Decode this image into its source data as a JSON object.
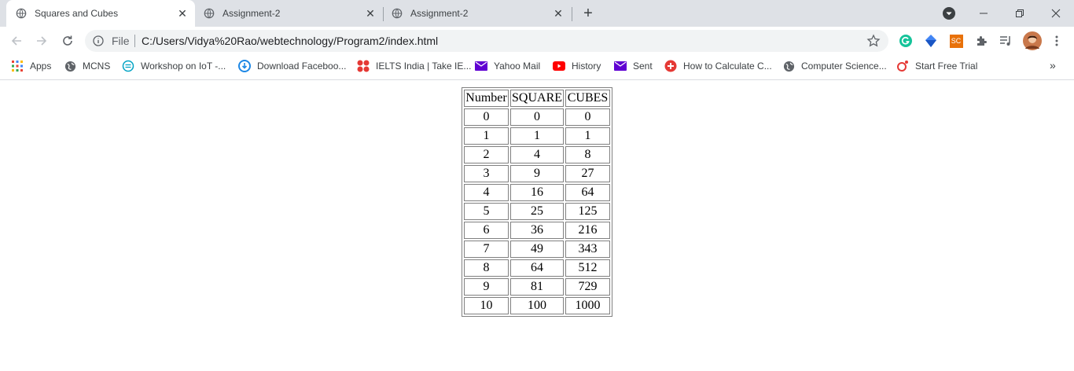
{
  "tabs": [
    {
      "title": "Squares and Cubes",
      "active": true
    },
    {
      "title": "Assignment-2",
      "active": false
    },
    {
      "title": "Assignment-2",
      "active": false
    }
  ],
  "address_bar": {
    "scheme_label": "File",
    "url": "C:/Users/Vidya%20Rao/webtechnology/Program2/index.html"
  },
  "extensions": [
    "grammarly-icon",
    "diamond-extension-icon",
    "sc-extension-icon",
    "puzzle-extensions-icon",
    "reading-list-icon",
    "avatar"
  ],
  "extension_sc_label": "SC",
  "bookmarks": [
    {
      "label": "Apps",
      "icon": "apps-grid-icon"
    },
    {
      "label": "MCNS",
      "icon": "globe-icon"
    },
    {
      "label": "Workshop on IoT -...",
      "icon": "iot-icon"
    },
    {
      "label": "Download Faceboo...",
      "icon": "download-icon"
    },
    {
      "label": "IELTS India | Take IE...",
      "icon": "ielts-icon"
    },
    {
      "label": "Yahoo Mail",
      "icon": "yahoo-mail-icon"
    },
    {
      "label": "History",
      "icon": "youtube-icon"
    },
    {
      "label": "Sent",
      "icon": "yahoo-mail-icon"
    },
    {
      "label": "How to Calculate C...",
      "icon": "plus-circle-icon"
    },
    {
      "label": "Computer Science...",
      "icon": "globe-icon"
    },
    {
      "label": "Start Free Trial",
      "icon": "trial-icon"
    }
  ],
  "table": {
    "headers": [
      "Number",
      "SQUARE",
      "CUBES"
    ],
    "rows": [
      [
        "0",
        "0",
        "0"
      ],
      [
        "1",
        "1",
        "1"
      ],
      [
        "2",
        "4",
        "8"
      ],
      [
        "3",
        "9",
        "27"
      ],
      [
        "4",
        "16",
        "64"
      ],
      [
        "5",
        "25",
        "125"
      ],
      [
        "6",
        "36",
        "216"
      ],
      [
        "7",
        "49",
        "343"
      ],
      [
        "8",
        "64",
        "512"
      ],
      [
        "9",
        "81",
        "729"
      ],
      [
        "10",
        "100",
        "1000"
      ]
    ]
  },
  "colors": {
    "tabstrip_bg": "#dee1e6",
    "omnibox_bg": "#f1f3f4",
    "grammarly": "#15c39a",
    "sc_orange": "#e8710a",
    "youtube_red": "#ff0000",
    "yahoo_purple": "#6001d2"
  }
}
